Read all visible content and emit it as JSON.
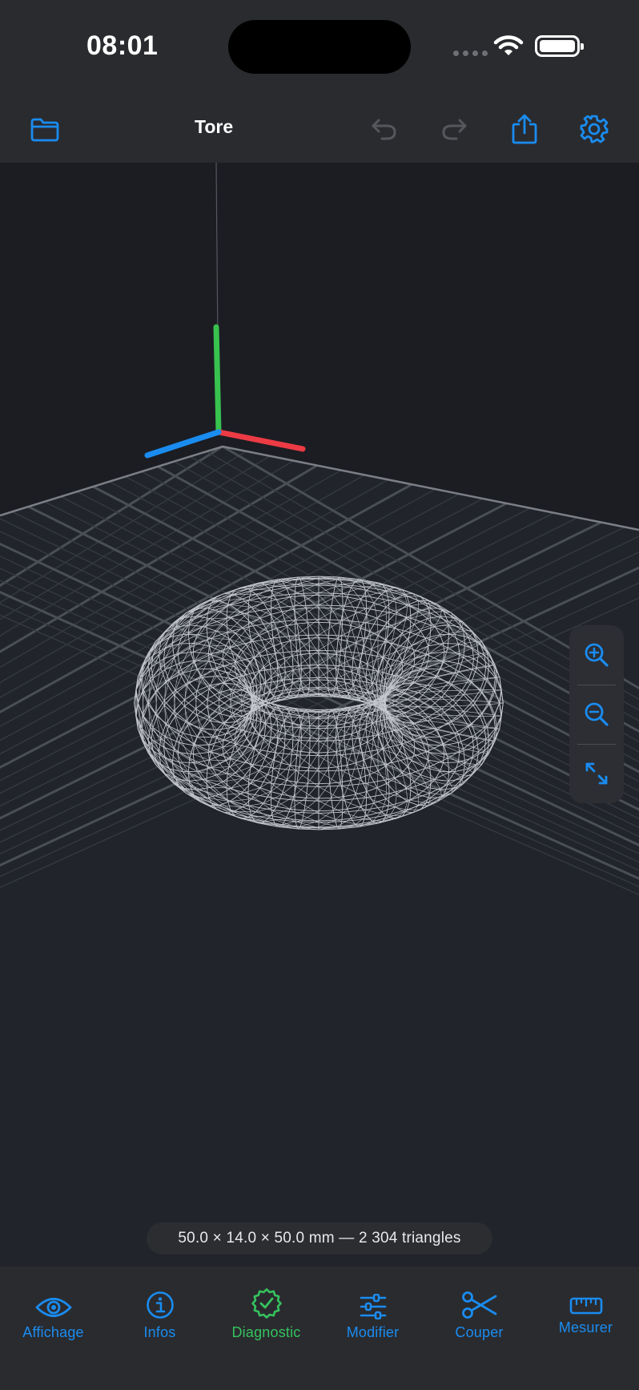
{
  "status_bar": {
    "time": "08:01"
  },
  "nav": {
    "title": "Tore"
  },
  "viewport": {
    "info": "50.0 × 14.0 × 50.0 mm — 2 304 triangles",
    "axis_colors": {
      "x": "#ec3b44",
      "y": "#38c24e",
      "z": "#1a8cf0"
    }
  },
  "icons": {
    "folder": "folder-icon",
    "undo": "undo-icon",
    "redo": "redo-icon",
    "share": "share-icon",
    "settings": "gear-icon",
    "zoom_in": "zoom-in-icon",
    "zoom_out": "zoom-out-icon",
    "fit": "fit-view-icon"
  },
  "tabs": [
    {
      "label": "Affichage",
      "icon": "eye-icon",
      "active": false
    },
    {
      "label": "Infos",
      "icon": "info-icon",
      "active": false
    },
    {
      "label": "Diagnostic",
      "icon": "checkmark-seal-icon",
      "active": true
    },
    {
      "label": "Modifier",
      "icon": "sliders-icon",
      "active": false
    },
    {
      "label": "Couper",
      "icon": "scissors-icon",
      "active": false
    },
    {
      "label": "Mesurer",
      "icon": "ruler-icon",
      "active": false
    }
  ],
  "colors": {
    "accent": "#1a8cf0",
    "active": "#35c35e",
    "disabled": "#56575c"
  }
}
